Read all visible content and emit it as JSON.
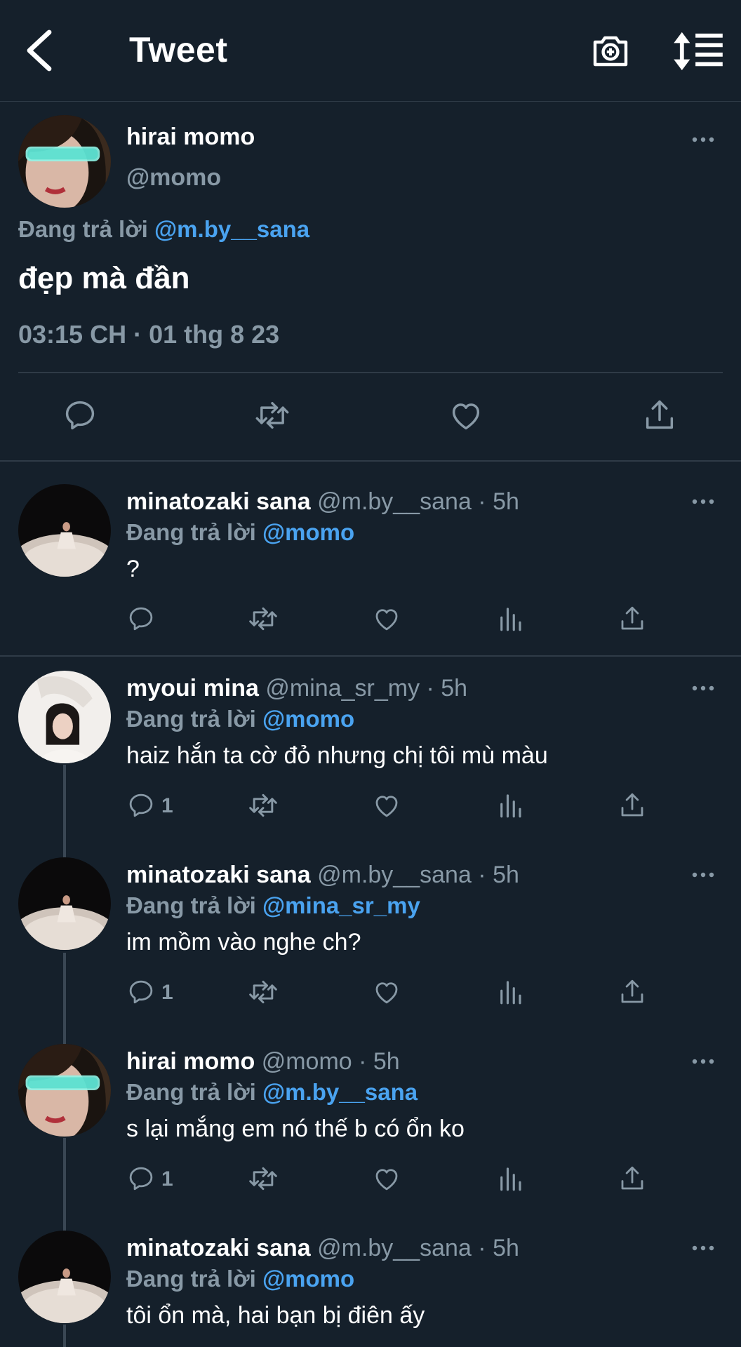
{
  "header": {
    "title": "Tweet",
    "icons": [
      "back-arrow-icon",
      "add-photo-camera-icon",
      "sort-icon"
    ]
  },
  "main_tweet": {
    "name": "hirai momo",
    "handle": "@momo",
    "reply_prefix": "Đang trả lời",
    "reply_to": "@m.by__sana",
    "text": "đẹp mà đần",
    "timestamp": "03:15 CH · 01 thg 8 23"
  },
  "replies": [
    {
      "name": "minatozaki sana",
      "meta": "@m.by__sana · 5h",
      "reply_prefix": "Đang trả lời",
      "reply_to": "@momo",
      "text": "?",
      "reply_count": ""
    },
    {
      "name": "myoui mina",
      "meta": "@mina_sr_my · 5h",
      "reply_prefix": "Đang trả lời",
      "reply_to": "@momo",
      "text": "haiz hắn ta cờ đỏ nhưng chị tôi mù màu",
      "reply_count": "1"
    },
    {
      "name": "minatozaki sana",
      "meta": "@m.by__sana · 5h",
      "reply_prefix": "Đang trả lời",
      "reply_to": "@mina_sr_my",
      "text": "im mồm vào nghe ch?",
      "reply_count": "1"
    },
    {
      "name": "hirai momo",
      "meta": "@momo · 5h",
      "reply_prefix": "Đang trả lời",
      "reply_to": "@m.by__sana",
      "text": "s lại mắng em nó thế b có ổn ko",
      "reply_count": "1"
    },
    {
      "name": "minatozaki sana",
      "meta": "@m.by__sana · 5h",
      "reply_prefix": "Đang trả lời",
      "reply_to": "@momo",
      "text": "tôi ổn mà, hai bạn bị điên ấy",
      "reply_count": ""
    }
  ],
  "colors": {
    "background": "#15202b",
    "secondary_text": "#8899a6",
    "mention": "#4aa3f0",
    "divider": "#2f3b47"
  }
}
